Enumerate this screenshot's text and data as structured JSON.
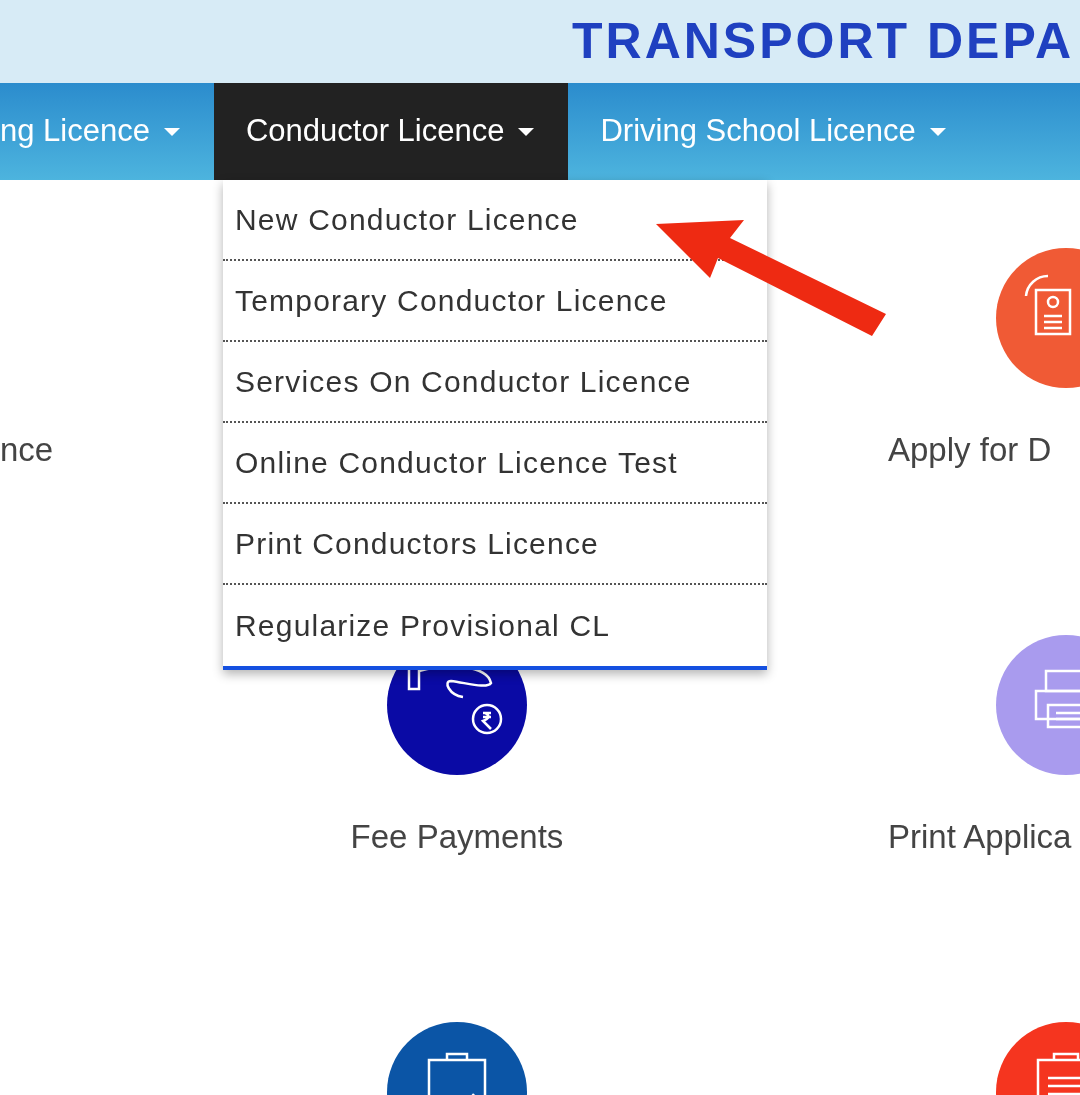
{
  "header": {
    "title": "TRANSPORT DEPA"
  },
  "nav": [
    {
      "label": "ng Licence",
      "selected": false
    },
    {
      "label": "Conductor Licence",
      "selected": true
    },
    {
      "label": "Driving School Licence",
      "selected": false
    }
  ],
  "dropdown": {
    "items": [
      "New Conductor Licence",
      "Temporary Conductor Licence",
      "Services On Conductor Licence",
      "Online Conductor Licence Test",
      "Print Conductors Licence",
      "Regularize Provisional CL"
    ]
  },
  "rows": [
    [
      {
        "label": "nce"
      },
      null,
      {
        "kind": "licence",
        "label": "Apply for D"
      }
    ],
    [
      null,
      {
        "kind": "payment",
        "label": "Fee Payments"
      },
      {
        "kind": "printer",
        "label": "Print Applica"
      }
    ],
    [
      null,
      {
        "kind": "checklist"
      },
      {
        "kind": "clipboard"
      }
    ]
  ]
}
